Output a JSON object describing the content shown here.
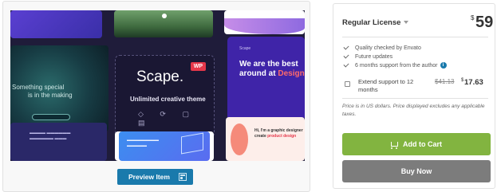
{
  "preview": {
    "button_label": "Preview Item",
    "image": {
      "ocean_line1": "Something special",
      "ocean_line2": "is in the making",
      "scape_title": "Scape.",
      "scape_badge": "WP",
      "scape_subtitle": "Unlimited creative theme",
      "best_brand": "Scape",
      "best_line1": "We are the best",
      "best_line2": "around at",
      "best_accent": "Design",
      "pink_line1": "Hi, I'm a graphic designer",
      "pink_line2": "create",
      "pink_accent": "product design"
    }
  },
  "purchase": {
    "license_name": "Regular License",
    "price_currency": "$",
    "price_amount": "59",
    "features": [
      "Quality checked by Envato",
      "Future updates",
      "6 months support from the author"
    ],
    "extend_label": "Extend support to 12 months",
    "extend_old_price": "$41.13",
    "extend_new_currency": "$",
    "extend_new_price": "17.63",
    "price_note": "Price is in US dollars. Price displayed excludes any applicable taxes.",
    "add_to_cart_label": "Add to Cart",
    "buy_now_label": "Buy Now"
  },
  "colors": {
    "add_to_cart": "#82b440",
    "buy_now": "#7c7c7c",
    "preview_button": "#1a7aac"
  }
}
